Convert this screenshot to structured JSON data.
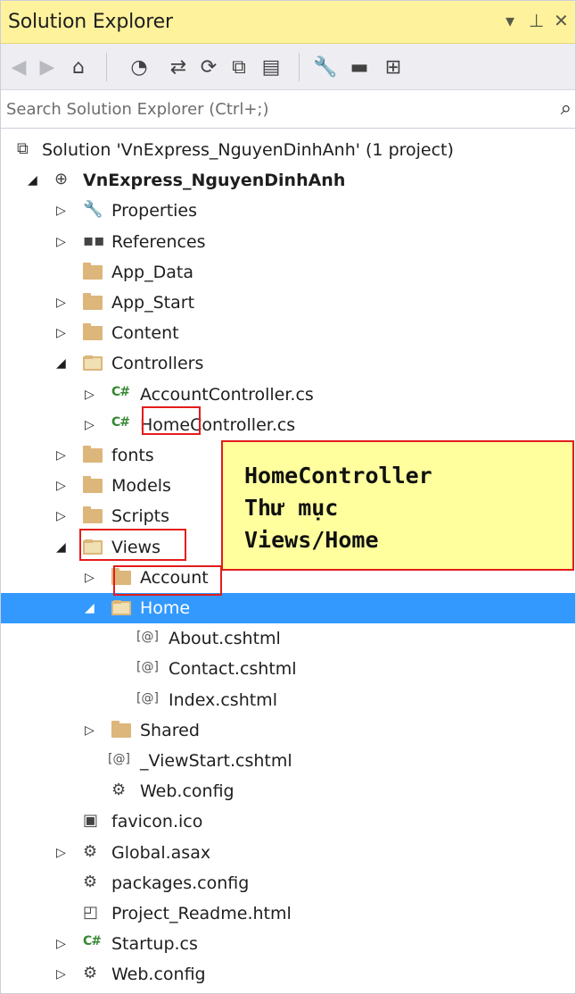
{
  "window": {
    "title": "Solution Explorer",
    "controls": {
      "dropdown": "▾",
      "pin": "⊥",
      "close": "✕"
    }
  },
  "toolbar": {
    "buttons": [
      {
        "name": "back-icon",
        "glyph": "◀"
      },
      {
        "name": "forward-icon",
        "glyph": "▶"
      },
      {
        "name": "home-icon",
        "glyph": "⌂"
      },
      {
        "name": "pending-changes-icon",
        "glyph": "◔"
      },
      {
        "name": "sync-icon",
        "glyph": "⇄"
      },
      {
        "name": "refresh-icon",
        "glyph": "⟳"
      },
      {
        "name": "collapse-all-icon",
        "glyph": "⧉"
      },
      {
        "name": "show-all-files-icon",
        "glyph": "▤"
      },
      {
        "name": "properties-icon",
        "glyph": "🔧"
      },
      {
        "name": "preview-icon",
        "glyph": "▬"
      },
      {
        "name": "class-view-icon",
        "glyph": "⊞"
      }
    ]
  },
  "search": {
    "placeholder": "Search Solution Explorer (Ctrl+;)",
    "icon": "⌕"
  },
  "tree": [
    {
      "label": "Solution 'VnExpress_NguyenDinhAnh' (1 project)",
      "type": "solution",
      "level": 0,
      "arrow": ""
    },
    {
      "label": "VnExpress_NguyenDinhAnh",
      "type": "project",
      "level": 0,
      "arrow": "expanded",
      "bold": true
    },
    {
      "label": "Properties",
      "type": "properties",
      "level": 1,
      "arrow": "collapsed"
    },
    {
      "label": "References",
      "type": "references",
      "level": 1,
      "arrow": "collapsed"
    },
    {
      "label": "App_Data",
      "type": "folder",
      "level": 1,
      "arrow": ""
    },
    {
      "label": "App_Start",
      "type": "folder",
      "level": 1,
      "arrow": "collapsed"
    },
    {
      "label": "Content",
      "type": "folder",
      "level": 1,
      "arrow": "collapsed"
    },
    {
      "label": "Controllers",
      "type": "folder-open",
      "level": 1,
      "arrow": "expanded"
    },
    {
      "label": "AccountController.cs",
      "type": "cs",
      "level": 2,
      "arrow": "collapsed"
    },
    {
      "label": "HomeController.cs",
      "type": "cs",
      "level": 2,
      "arrow": "collapsed"
    },
    {
      "label": "fonts",
      "type": "folder",
      "level": 1,
      "arrow": "collapsed"
    },
    {
      "label": "Models",
      "type": "folder",
      "level": 1,
      "arrow": "collapsed"
    },
    {
      "label": "Scripts",
      "type": "folder",
      "level": 1,
      "arrow": "collapsed"
    },
    {
      "label": "Views",
      "type": "folder-open",
      "level": 1,
      "arrow": "expanded"
    },
    {
      "label": "Account",
      "type": "folder",
      "level": 2,
      "arrow": "collapsed"
    },
    {
      "label": "Home",
      "type": "folder-open",
      "level": 2,
      "arrow": "expanded",
      "selected": true
    },
    {
      "label": "About.cshtml",
      "type": "razor",
      "level": 3,
      "arrow": ""
    },
    {
      "label": "Contact.cshtml",
      "type": "razor",
      "level": 3,
      "arrow": ""
    },
    {
      "label": "Index.cshtml",
      "type": "razor",
      "level": 3,
      "arrow": ""
    },
    {
      "label": "Shared",
      "type": "folder",
      "level": 2,
      "arrow": "collapsed"
    },
    {
      "label": "_ViewStart.cshtml",
      "type": "razor",
      "level": 2,
      "arrow": ""
    },
    {
      "label": "Web.config",
      "type": "config",
      "level": 2,
      "arrow": ""
    },
    {
      "label": "favicon.ico",
      "type": "ico",
      "level": 1,
      "arrow": ""
    },
    {
      "label": "Global.asax",
      "type": "asax",
      "level": 1,
      "arrow": "collapsed"
    },
    {
      "label": "packages.config",
      "type": "config",
      "level": 1,
      "arrow": ""
    },
    {
      "label": "Project_Readme.html",
      "type": "html",
      "level": 1,
      "arrow": ""
    },
    {
      "label": "Startup.cs",
      "type": "cs",
      "level": 1,
      "arrow": "collapsed"
    },
    {
      "label": "Web.config",
      "type": "config",
      "level": 1,
      "arrow": "collapsed"
    }
  ],
  "callout": {
    "lines": [
      "HomeController",
      "Thư mục",
      "Views/Home"
    ]
  },
  "colors": {
    "selection": "#3399ff",
    "title_bg": "#fff29d",
    "callout_bg": "#ffff9e",
    "highlight_border": "#e31c1c"
  }
}
